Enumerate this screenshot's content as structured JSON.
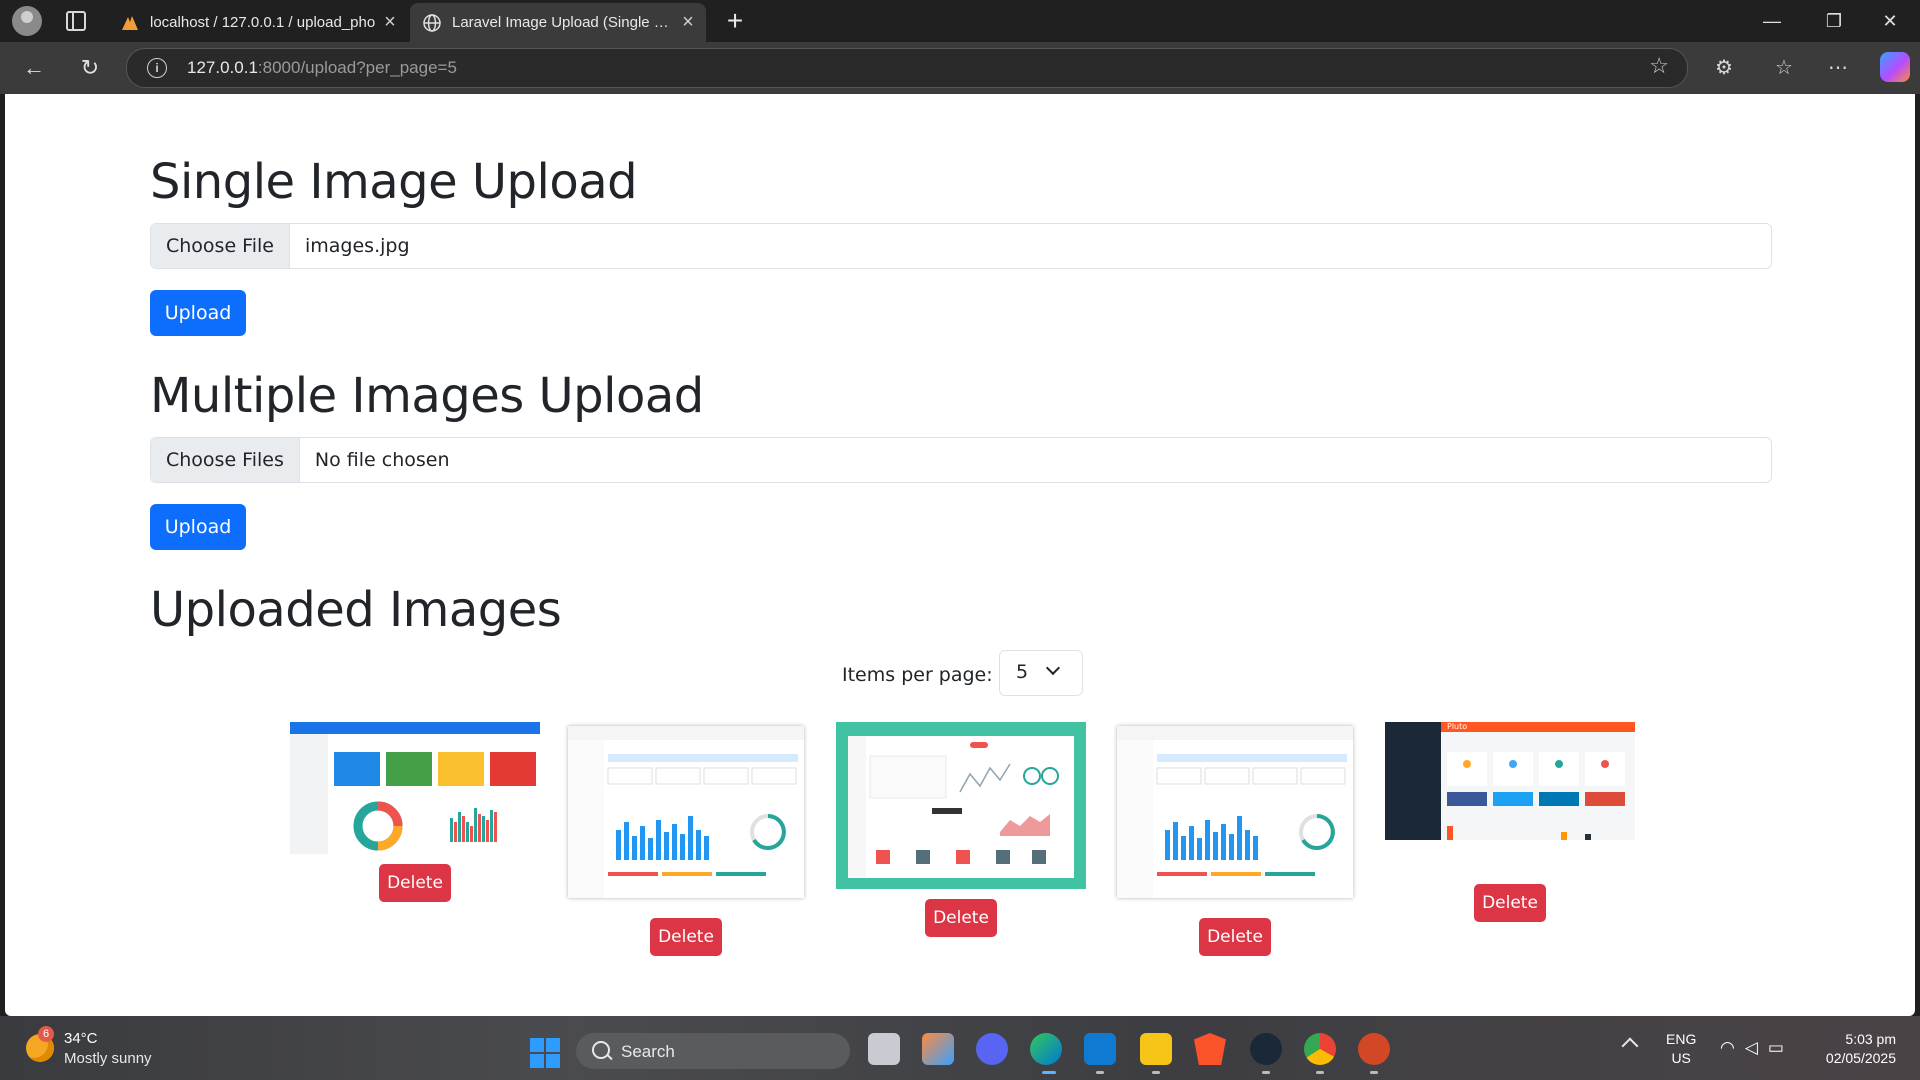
{
  "browser": {
    "tabs": [
      {
        "title": "localhost / 127.0.0.1 / upload_pho",
        "active": false,
        "icon": "phpmyadmin-icon"
      },
      {
        "title": "Laravel Image Upload (Single + M",
        "active": true,
        "icon": "globe-icon"
      }
    ],
    "url_host": "127.0.0.1",
    "url_path": ":8000/upload?per_page=5"
  },
  "page": {
    "single": {
      "heading": "Single Image Upload",
      "button_label": "Choose File",
      "file_name": "images.jpg",
      "upload_label": "Upload"
    },
    "multiple": {
      "heading": "Multiple Images Upload",
      "button_label": "Choose Files",
      "file_name": "No file chosen",
      "upload_label": "Upload"
    },
    "uploaded": {
      "heading": "Uploaded Images",
      "per_page_label": "Items per page:",
      "per_page_value": "5",
      "delete_label": "Delete",
      "images": [
        {
          "style": "blue-dashboard"
        },
        {
          "style": "light-dashboard"
        },
        {
          "style": "teal-dashboard"
        },
        {
          "style": "light-dashboard"
        },
        {
          "style": "dark-dashboard",
          "brand_text": "Pluto"
        }
      ]
    }
  },
  "taskbar": {
    "weather_badge": "6",
    "temperature": "34°C",
    "weather": "Mostly sunny",
    "search_placeholder": "Search",
    "lang_1": "ENG",
    "lang_2": "US",
    "time": "5:03 pm",
    "date": "02/05/2025"
  },
  "colors": {
    "primary": "#0d6efd",
    "danger": "#dc3545"
  }
}
